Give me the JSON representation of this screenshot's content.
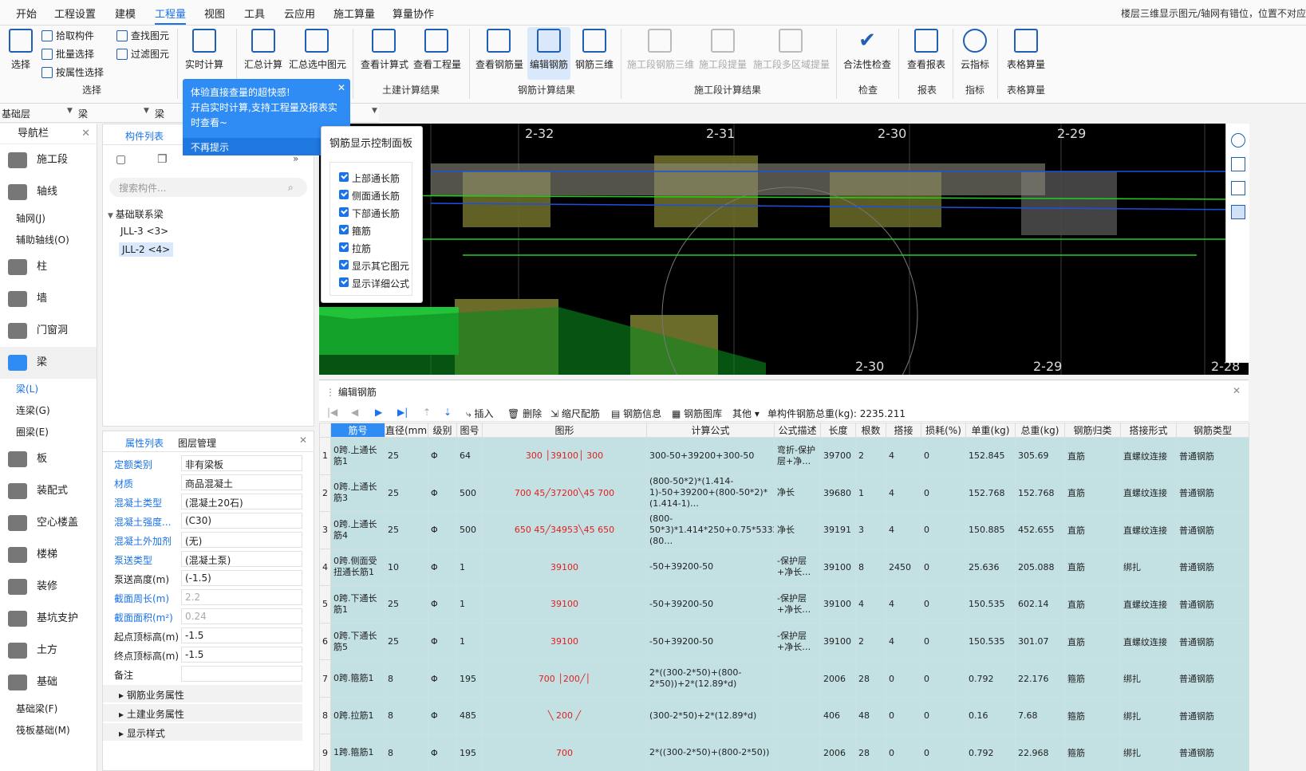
{
  "menu": [
    "开始",
    "工程设置",
    "建模",
    "工程量",
    "视图",
    "工具",
    "云应用",
    "施工算量",
    "算量协作"
  ],
  "menu_active": "工程量",
  "hint": "楼层三维显示图元/轴网有错位，位置不对应",
  "ribbon": {
    "select": {
      "label": "选择",
      "pick": "拾取构件",
      "batch": "批量选择",
      "by_attr": "按属性选择",
      "find": "查找图元",
      "filter": "过滤图元",
      "group": "选择"
    },
    "realtime": "实时计算",
    "sum": "汇总计算",
    "sum_sel": "汇总选中图元",
    "civil": {
      "formula": "查看计算式",
      "qty": "查看工程量",
      "group": "土建计算结果"
    },
    "rebar": {
      "view": "查看钢筋量",
      "edit": "编辑钢筋",
      "view3d": "钢筋三维",
      "group": "钢筋计算结果"
    },
    "stage": {
      "a": "施工段钢筋三维",
      "b": "施工段提量",
      "c": "施工段多区域提量",
      "group": "施工段计算结果"
    },
    "check": {
      "label": "合法性检查",
      "group": "检查"
    },
    "report": {
      "label": "查看报表",
      "group": "报表"
    },
    "cloud": {
      "label": "云指标",
      "group": "指标"
    },
    "table": {
      "label": "表格算量",
      "group": "表格算量"
    }
  },
  "filter": {
    "floor": "基础层",
    "type": "梁",
    "sub": "梁"
  },
  "nav": {
    "title": "导航栏",
    "items": [
      {
        "label": "施工段",
        "type": "item"
      },
      {
        "label": "轴线",
        "type": "item"
      },
      {
        "label": "轴网(J)",
        "type": "sub"
      },
      {
        "label": "辅助轴线(O)",
        "type": "sub"
      },
      {
        "label": "柱",
        "type": "item"
      },
      {
        "label": "墙",
        "type": "item"
      },
      {
        "label": "门窗洞",
        "type": "item"
      },
      {
        "label": "梁",
        "type": "item"
      },
      {
        "label": "梁(L)",
        "type": "sub",
        "on": true
      },
      {
        "label": "连梁(G)",
        "type": "sub"
      },
      {
        "label": "圈梁(E)",
        "type": "sub"
      },
      {
        "label": "板",
        "type": "item"
      },
      {
        "label": "装配式",
        "type": "item"
      },
      {
        "label": "空心楼盖",
        "type": "item"
      },
      {
        "label": "楼梯",
        "type": "item"
      },
      {
        "label": "装修",
        "type": "item"
      },
      {
        "label": "基坑支护",
        "type": "item"
      },
      {
        "label": "土方",
        "type": "item"
      },
      {
        "label": "基础",
        "type": "item"
      },
      {
        "label": "基础梁(F)",
        "type": "sub"
      },
      {
        "label": "筏板基础(M)",
        "type": "sub"
      }
    ]
  },
  "comp": {
    "tab": "构件列表",
    "search": "搜索构件...",
    "group": "基础联系梁",
    "items": [
      "JLL-3 <3>",
      "JLL-2 <4>"
    ]
  },
  "tip": {
    "line1": "体验直接查量的超快感!",
    "line2": "开启实时计算,支持工程量及报表实时查看~",
    "nomore": "不再提示"
  },
  "panel": {
    "title": "钢筋显示控制面板",
    "items": [
      "上部通长筋",
      "侧面通长筋",
      "下部通长筋",
      "箍筋",
      "拉筋",
      "显示其它图元",
      "显示详细公式"
    ]
  },
  "props": {
    "tabs": [
      "属性列表",
      "图层管理"
    ],
    "rows": [
      {
        "k": "定额类别",
        "v": "非有梁板",
        "link": true
      },
      {
        "k": "材质",
        "v": "商品混凝土",
        "link": true
      },
      {
        "k": "混凝土类型",
        "v": "(混凝土20石)",
        "link": true
      },
      {
        "k": "混凝土强度...",
        "v": "(C30)",
        "link": true
      },
      {
        "k": "混凝土外加剂",
        "v": "(无)",
        "link": true
      },
      {
        "k": "泵送类型",
        "v": "(混凝土泵)",
        "link": true
      },
      {
        "k": "泵送高度(m)",
        "v": "(-1.5)",
        "link": false
      },
      {
        "k": "截面周长(m)",
        "v": "2.2",
        "link": true,
        "gray": true
      },
      {
        "k": "截面面积(m²)",
        "v": "0.24",
        "link": true,
        "gray": true
      },
      {
        "k": "起点顶标高(m)",
        "v": "-1.5",
        "link": false
      },
      {
        "k": "终点顶标高(m)",
        "v": "-1.5",
        "link": false
      },
      {
        "k": "备注",
        "v": "",
        "link": false
      }
    ],
    "groups": [
      "钢筋业务属性",
      "土建业务属性",
      "显示样式"
    ]
  },
  "viewport": {
    "axes_top": [
      "2-32",
      "2-31",
      "2-30",
      "2-29"
    ],
    "axes_bottom": [
      "2-30",
      "2-29",
      "2-28"
    ]
  },
  "rebar": {
    "title": "编辑钢筋",
    "tools": [
      "插入",
      "删除",
      "缩尺配筋",
      "钢筋信息",
      "钢筋图库",
      "其他"
    ],
    "total_label": "单构件钢筋总重(kg): 2235.211",
    "headers": [
      "筋号",
      "直径(mm)",
      "级别",
      "图号",
      "图形",
      "计算公式",
      "公式描述",
      "长度",
      "根数",
      "搭接",
      "损耗(%)",
      "单重(kg)",
      "总重(kg)",
      "钢筋归类",
      "搭接形式",
      "钢筋类型"
    ],
    "rows": [
      {
        "n": "1",
        "name": "0跨.上通长筋1",
        "d": "25",
        "g": "Φ",
        "fig": "64",
        "shape": "300 │39100│ 300",
        "formula": "300-50+39200+300-50",
        "desc": "弯折-保护层+净…",
        "len": "39700",
        "cnt": "2",
        "lap": "4",
        "loss": "0",
        "unit": "152.845",
        "tot": "305.69",
        "cls": "直筋",
        "lapf": "直螺纹连接",
        "type": "普通钢筋"
      },
      {
        "n": "2",
        "name": "0跨.上通长筋3",
        "d": "25",
        "g": "Φ",
        "fig": "500",
        "shape": "700  45╱37200╲45  700",
        "formula": "(800-50*2)*(1.414-1)-50+39200+(800-50*2)*(1.414-1)…",
        "desc": "净长",
        "len": "39680",
        "cnt": "1",
        "lap": "4",
        "loss": "0",
        "unit": "152.768",
        "tot": "152.768",
        "cls": "直筋",
        "lapf": "直螺纹连接",
        "type": "普通钢筋"
      },
      {
        "n": "3",
        "name": "0跨.上通长筋4",
        "d": "25",
        "g": "Φ",
        "fig": "500",
        "shape": "650  45╱34953╲45  650",
        "formula": "(800-50*3)*1.414*250+0.75*5332+29812+0.75*4056+(80…",
        "desc": "净长",
        "len": "39191",
        "cnt": "3",
        "lap": "4",
        "loss": "0",
        "unit": "150.885",
        "tot": "452.655",
        "cls": "直筋",
        "lapf": "直螺纹连接",
        "type": "普通钢筋"
      },
      {
        "n": "4",
        "name": "0跨.侧面受扭通长筋1",
        "d": "10",
        "g": "Φ",
        "fig": "1",
        "shape": "39100",
        "formula": "-50+39200-50",
        "desc": "-保护层+净长…",
        "len": "39100",
        "cnt": "8",
        "lap": "2450",
        "loss": "0",
        "unit": "25.636",
        "tot": "205.088",
        "cls": "直筋",
        "lapf": "绑扎",
        "type": "普通钢筋"
      },
      {
        "n": "5",
        "name": "0跨.下通长筋1",
        "d": "25",
        "g": "Φ",
        "fig": "1",
        "shape": "39100",
        "formula": "-50+39200-50",
        "desc": "-保护层+净长…",
        "len": "39100",
        "cnt": "4",
        "lap": "4",
        "loss": "0",
        "unit": "150.535",
        "tot": "602.14",
        "cls": "直筋",
        "lapf": "直螺纹连接",
        "type": "普通钢筋"
      },
      {
        "n": "6",
        "name": "0跨.下通长筋5",
        "d": "25",
        "g": "Φ",
        "fig": "1",
        "shape": "39100",
        "formula": "-50+39200-50",
        "desc": "-保护层+净长…",
        "len": "39100",
        "cnt": "2",
        "lap": "4",
        "loss": "0",
        "unit": "150.535",
        "tot": "301.07",
        "cls": "直筋",
        "lapf": "直螺纹连接",
        "type": "普通钢筋"
      },
      {
        "n": "7",
        "name": "0跨.箍筋1",
        "d": "8",
        "g": "Φ",
        "fig": "195",
        "shape": "700 │200╱│",
        "formula": "2*((300-2*50)+(800-2*50))+2*(12.89*d)",
        "desc": "",
        "len": "2006",
        "cnt": "28",
        "lap": "0",
        "loss": "0",
        "unit": "0.792",
        "tot": "22.176",
        "cls": "箍筋",
        "lapf": "绑扎",
        "type": "普通钢筋"
      },
      {
        "n": "8",
        "name": "0跨.拉筋1",
        "d": "8",
        "g": "Φ",
        "fig": "485",
        "shape": "╲ 200 ╱",
        "formula": "(300-2*50)+2*(12.89*d)",
        "desc": "",
        "len": "406",
        "cnt": "48",
        "lap": "0",
        "loss": "0",
        "unit": "0.16",
        "tot": "7.68",
        "cls": "箍筋",
        "lapf": "绑扎",
        "type": "普通钢筋"
      },
      {
        "n": "9",
        "name": "1跨.箍筋1",
        "d": "8",
        "g": "Φ",
        "fig": "195",
        "shape": "700",
        "formula": "2*((300-2*50)+(800-2*50))",
        "desc": "",
        "len": "2006",
        "cnt": "28",
        "lap": "0",
        "loss": "0",
        "unit": "0.792",
        "tot": "22.968",
        "cls": "箍筋",
        "lapf": "绑扎",
        "type": "普通钢筋"
      }
    ]
  }
}
